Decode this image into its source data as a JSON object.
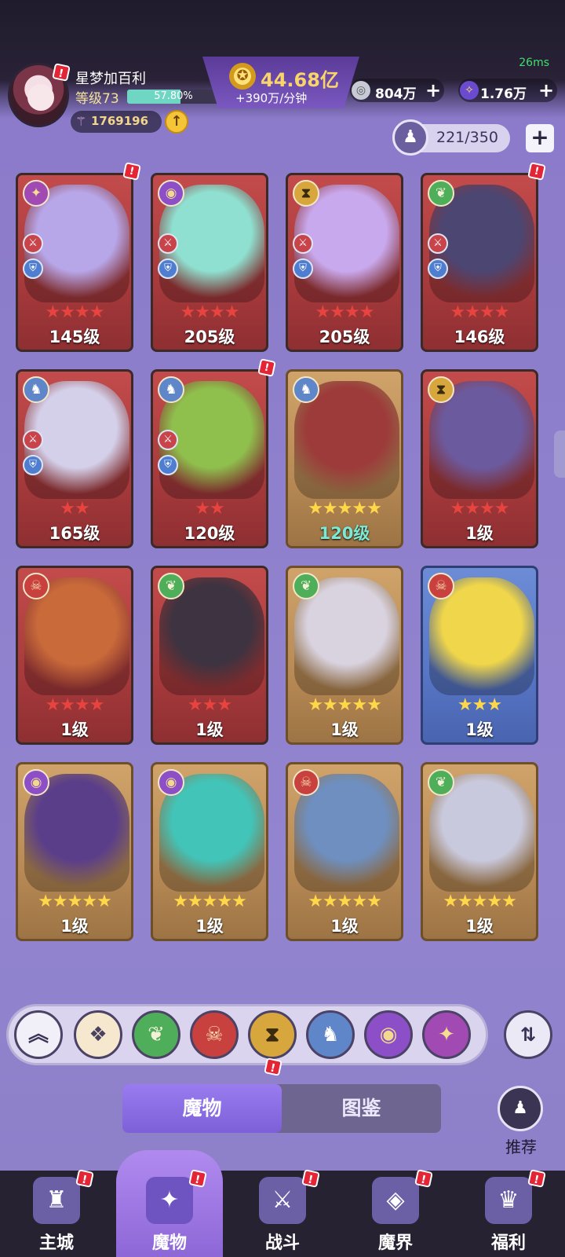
{
  "status": {
    "fps_text": "26ms"
  },
  "player": {
    "name": "星梦加百利",
    "level_text": "等级73",
    "exp_text": "57.80%",
    "exp_fraction": 0.578,
    "power": "1769196",
    "power_icon": "sword-icon",
    "upgrade_icon": "arrow-up-icon"
  },
  "currency": {
    "gold_amount": "44.68亿",
    "gold_rate": "+390万/分钟",
    "gems": "804万",
    "crystals": "1.76万",
    "plus": "+"
  },
  "capacity": {
    "value": "221/350",
    "plus": "+"
  },
  "colors": {
    "accent": "#8a79c9",
    "badge": "#e32536",
    "gold": "#f9d46a"
  },
  "cards": [
    {
      "faction": "chaos",
      "glyph": "✦",
      "stars": "★★★★",
      "star_color": "red",
      "level": "145级",
      "frame": "red",
      "art": "#b7a6e8",
      "badge": true,
      "sword": true,
      "shield": true
    },
    {
      "faction": "eye",
      "glyph": "◉",
      "stars": "★★★★",
      "star_color": "red",
      "level": "205级",
      "frame": "red",
      "art": "#8fe0d0",
      "badge": false,
      "sword": true,
      "shield": true
    },
    {
      "faction": "hourglass",
      "glyph": "⧗",
      "stars": "★★★★",
      "star_color": "red",
      "level": "205级",
      "frame": "red",
      "art": "#c9a9ee",
      "badge": false,
      "sword": true,
      "shield": true
    },
    {
      "faction": "leaf",
      "glyph": "❦",
      "stars": "★★★★",
      "star_color": "red",
      "level": "146级",
      "frame": "red",
      "art": "#4c4672",
      "badge": true,
      "sword": true,
      "shield": true
    },
    {
      "faction": "dragon",
      "glyph": "♞",
      "stars": "★★",
      "star_color": "red",
      "level": "165级",
      "frame": "red",
      "art": "#d4d0ea",
      "badge": false,
      "sword": true,
      "shield": true
    },
    {
      "faction": "dragon",
      "glyph": "♞",
      "stars": "★★",
      "star_color": "red",
      "level": "120级",
      "frame": "red",
      "art": "#8fbf4d",
      "badge": true,
      "sword": true,
      "shield": true
    },
    {
      "faction": "dragon",
      "glyph": "♞",
      "stars": "★★★★★",
      "star_color": "gold",
      "level": "120级",
      "frame": "gold",
      "art": "#9d3a3a",
      "badge": false,
      "sword": false,
      "shield": false,
      "teal": true
    },
    {
      "faction": "hourglass",
      "glyph": "⧗",
      "stars": "★★★★",
      "star_color": "red",
      "level": "1级",
      "frame": "red",
      "art": "#6c5a9e",
      "badge": false,
      "sword": false,
      "shield": false
    },
    {
      "faction": "demon",
      "glyph": "☠",
      "stars": "★★★★",
      "star_color": "red",
      "level": "1级",
      "frame": "red",
      "art": "#c96a3a",
      "badge": false,
      "sword": false,
      "shield": false
    },
    {
      "faction": "leaf",
      "glyph": "❦",
      "stars": "★★★",
      "star_color": "red",
      "level": "1级",
      "frame": "red",
      "art": "#3e3340",
      "badge": false,
      "sword": false,
      "shield": false
    },
    {
      "faction": "leaf",
      "glyph": "❦",
      "stars": "★★★★★",
      "star_color": "gold",
      "level": "1级",
      "frame": "gold",
      "art": "#d9d3e0",
      "badge": false,
      "sword": false,
      "shield": false
    },
    {
      "faction": "demon",
      "glyph": "☠",
      "stars": "★★★",
      "star_color": "gold",
      "level": "1级",
      "frame": "blue",
      "art": "#f0d64a",
      "badge": false,
      "sword": false,
      "shield": false
    },
    {
      "faction": "eye",
      "glyph": "◉",
      "stars": "★★★★★",
      "star_color": "gold",
      "level": "1级",
      "frame": "gold",
      "art": "#5b3e8a",
      "badge": false,
      "sword": false,
      "shield": false
    },
    {
      "faction": "eye",
      "glyph": "◉",
      "stars": "★★★★★",
      "star_color": "gold",
      "level": "1级",
      "frame": "gold",
      "art": "#42c4b8",
      "badge": false,
      "sword": false,
      "shield": false
    },
    {
      "faction": "demon",
      "glyph": "☠",
      "stars": "★★★★★",
      "star_color": "gold",
      "level": "1级",
      "frame": "gold",
      "art": "#6e8fbf",
      "badge": false,
      "sword": false,
      "shield": false
    },
    {
      "faction": "leaf",
      "glyph": "❦",
      "stars": "★★★★★",
      "star_color": "gold",
      "level": "1级",
      "frame": "gold",
      "art": "#c9c9dd",
      "badge": false,
      "sword": false,
      "shield": false
    }
  ],
  "filters": [
    {
      "name": "collapse",
      "glyph": "︽",
      "bg": "#f1eff8",
      "fg": "#3b3357"
    },
    {
      "name": "all",
      "glyph": "❖",
      "bg": "#f5e8cf",
      "fg": "#4a4160"
    },
    {
      "name": "leaf",
      "glyph": "❦",
      "bg": "#4fae5a",
      "fg": "#f3f0d8"
    },
    {
      "name": "demon",
      "glyph": "☠",
      "bg": "#c8413e",
      "fg": "#f7dcb0"
    },
    {
      "name": "hourglass",
      "glyph": "⧗",
      "bg": "#d7a73d",
      "fg": "#3a2a10"
    },
    {
      "name": "dragon",
      "glyph": "♞",
      "bg": "#5e86c8",
      "fg": "#ffffff"
    },
    {
      "name": "eye",
      "glyph": "◉",
      "bg": "#8c4fc7",
      "fg": "#f1d98d"
    },
    {
      "name": "chaos",
      "glyph": "✦",
      "bg": "#a14ab3",
      "fg": "#f5dd91"
    }
  ],
  "sort_glyph": "⇅",
  "tabs": {
    "active": "魔物",
    "inactive": "图鉴"
  },
  "recommend": {
    "label": "推荐",
    "glyph": "♟"
  },
  "nav": [
    {
      "label": "主城",
      "glyph": "♜",
      "color": "#6b5fa6"
    },
    {
      "label": "魔物",
      "glyph": "✦",
      "color": "#6d54c0"
    },
    {
      "label": "战斗",
      "glyph": "⚔",
      "color": "#6b5fa6"
    },
    {
      "label": "魔界",
      "glyph": "◈",
      "color": "#6b5fa6"
    },
    {
      "label": "福利",
      "glyph": "♛",
      "color": "#6b5fa6"
    }
  ],
  "badge_text": "!"
}
